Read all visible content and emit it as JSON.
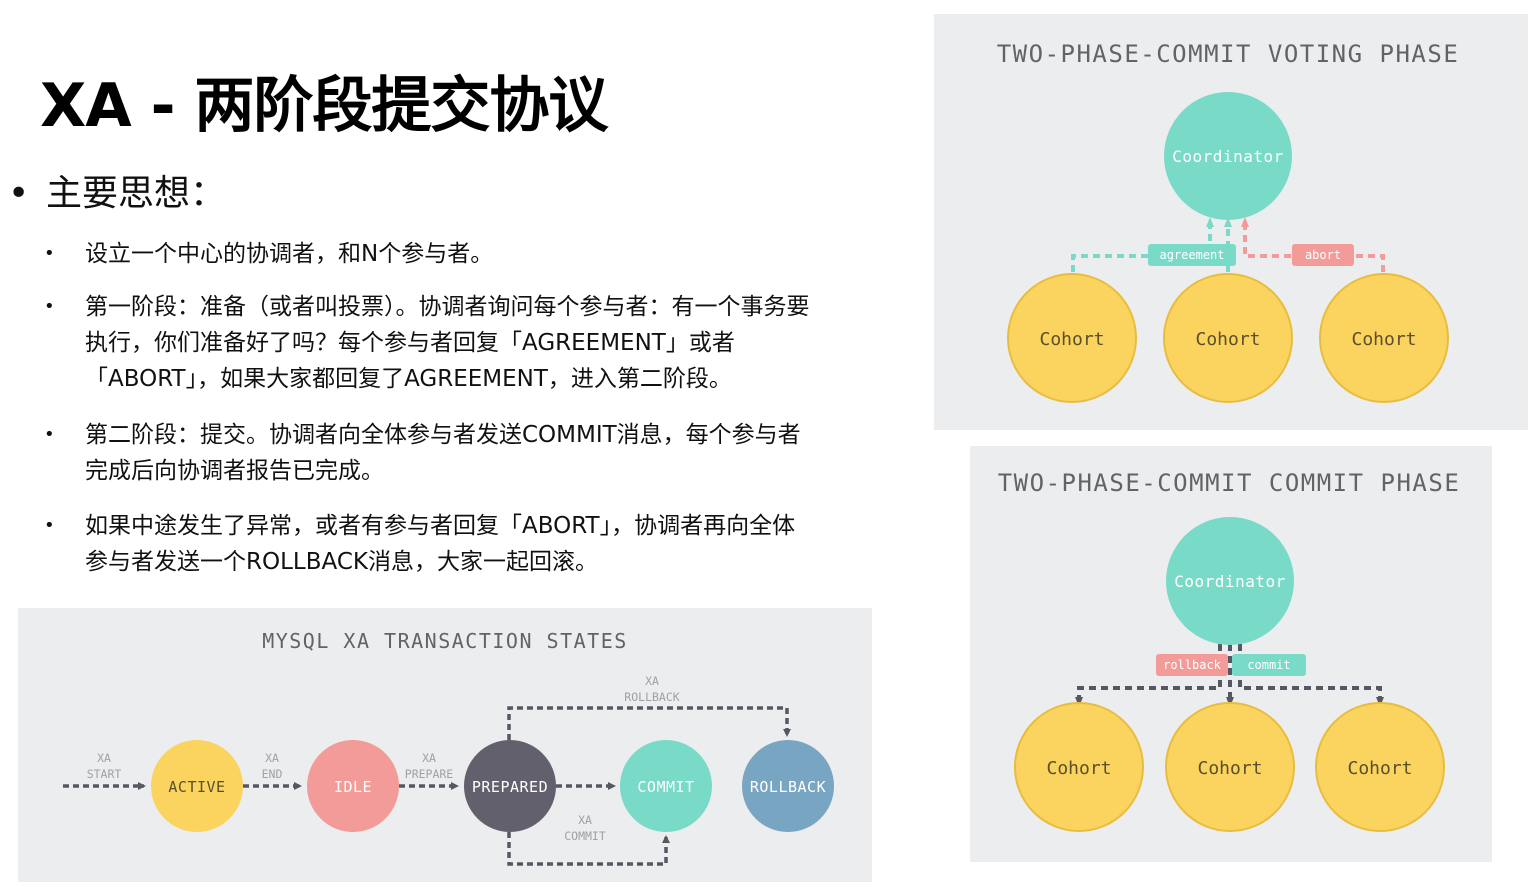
{
  "title": "XA - 两阶段提交协议",
  "main_point": {
    "bullet": "•",
    "text": "主要思想："
  },
  "sub_points": [
    {
      "lines": [
        "设立一个中心的协调者，和N个参与者。"
      ]
    },
    {
      "lines": [
        "第一阶段：准备（或者叫投票）。协调者询问每个参与者：有一个事务要",
        "执行，你们准备好了吗？每个参与者回复「AGREEMENT」或者",
        "「ABORT」，如果大家都回复了AGREEMENT，进入第二阶段。"
      ]
    },
    {
      "lines": [
        "第二阶段：提交。协调者向全体参与者发送COMMIT消息，每个参与者",
        "完成后向协调者报告已完成。"
      ]
    },
    {
      "lines": [
        "如果中途发生了异常，或者有参与者回复「ABORT」，协调者再向全体",
        "参与者发送一个ROLLBACK消息，大家一起回滚。"
      ]
    }
  ],
  "mysql_states": {
    "title": "MYSQL XA TRANSACTION STATES",
    "states": {
      "active": "ACTIVE",
      "idle": "IDLE",
      "prepared": "PREPARED",
      "commit": "COMMIT",
      "rollback": "ROLLBACK"
    },
    "edge_labels": {
      "start": [
        "XA",
        "START"
      ],
      "end": [
        "XA",
        "END"
      ],
      "prepare": [
        "XA",
        "PREPARE"
      ],
      "rollback": [
        "XA",
        "ROLLBACK"
      ],
      "commit": [
        "XA",
        "COMMIT"
      ]
    },
    "colors": {
      "active": "#fbd35f",
      "idle": "#f29b98",
      "prepared": "#62606c",
      "commit": "#79dac8",
      "rollback": "#78a5c1",
      "arrow": "#555862",
      "label": "#9ea1a6"
    }
  },
  "voting_phase": {
    "title": "TWO-PHASE-COMMIT VOTING PHASE",
    "coordinator": "Coordinator",
    "cohorts": [
      "Cohort",
      "Cohort",
      "Cohort"
    ],
    "agreement_label": "agreement",
    "abort_label": "abort"
  },
  "commit_phase": {
    "title": "TWO-PHASE-COMMIT COMMIT PHASE",
    "coordinator": "Coordinator",
    "cohorts": [
      "Cohort",
      "Cohort",
      "Cohort"
    ],
    "rollback_label": "rollback",
    "commit_label": "commit"
  },
  "colors": {
    "coordinator": "#79dac8",
    "cohort": "#fbd35f",
    "cohort_border": "#e8bd3f",
    "agreement": "#79dac8",
    "abort": "#f29b98",
    "panel_bg": "#ecedee",
    "panel_title": "#606368"
  }
}
